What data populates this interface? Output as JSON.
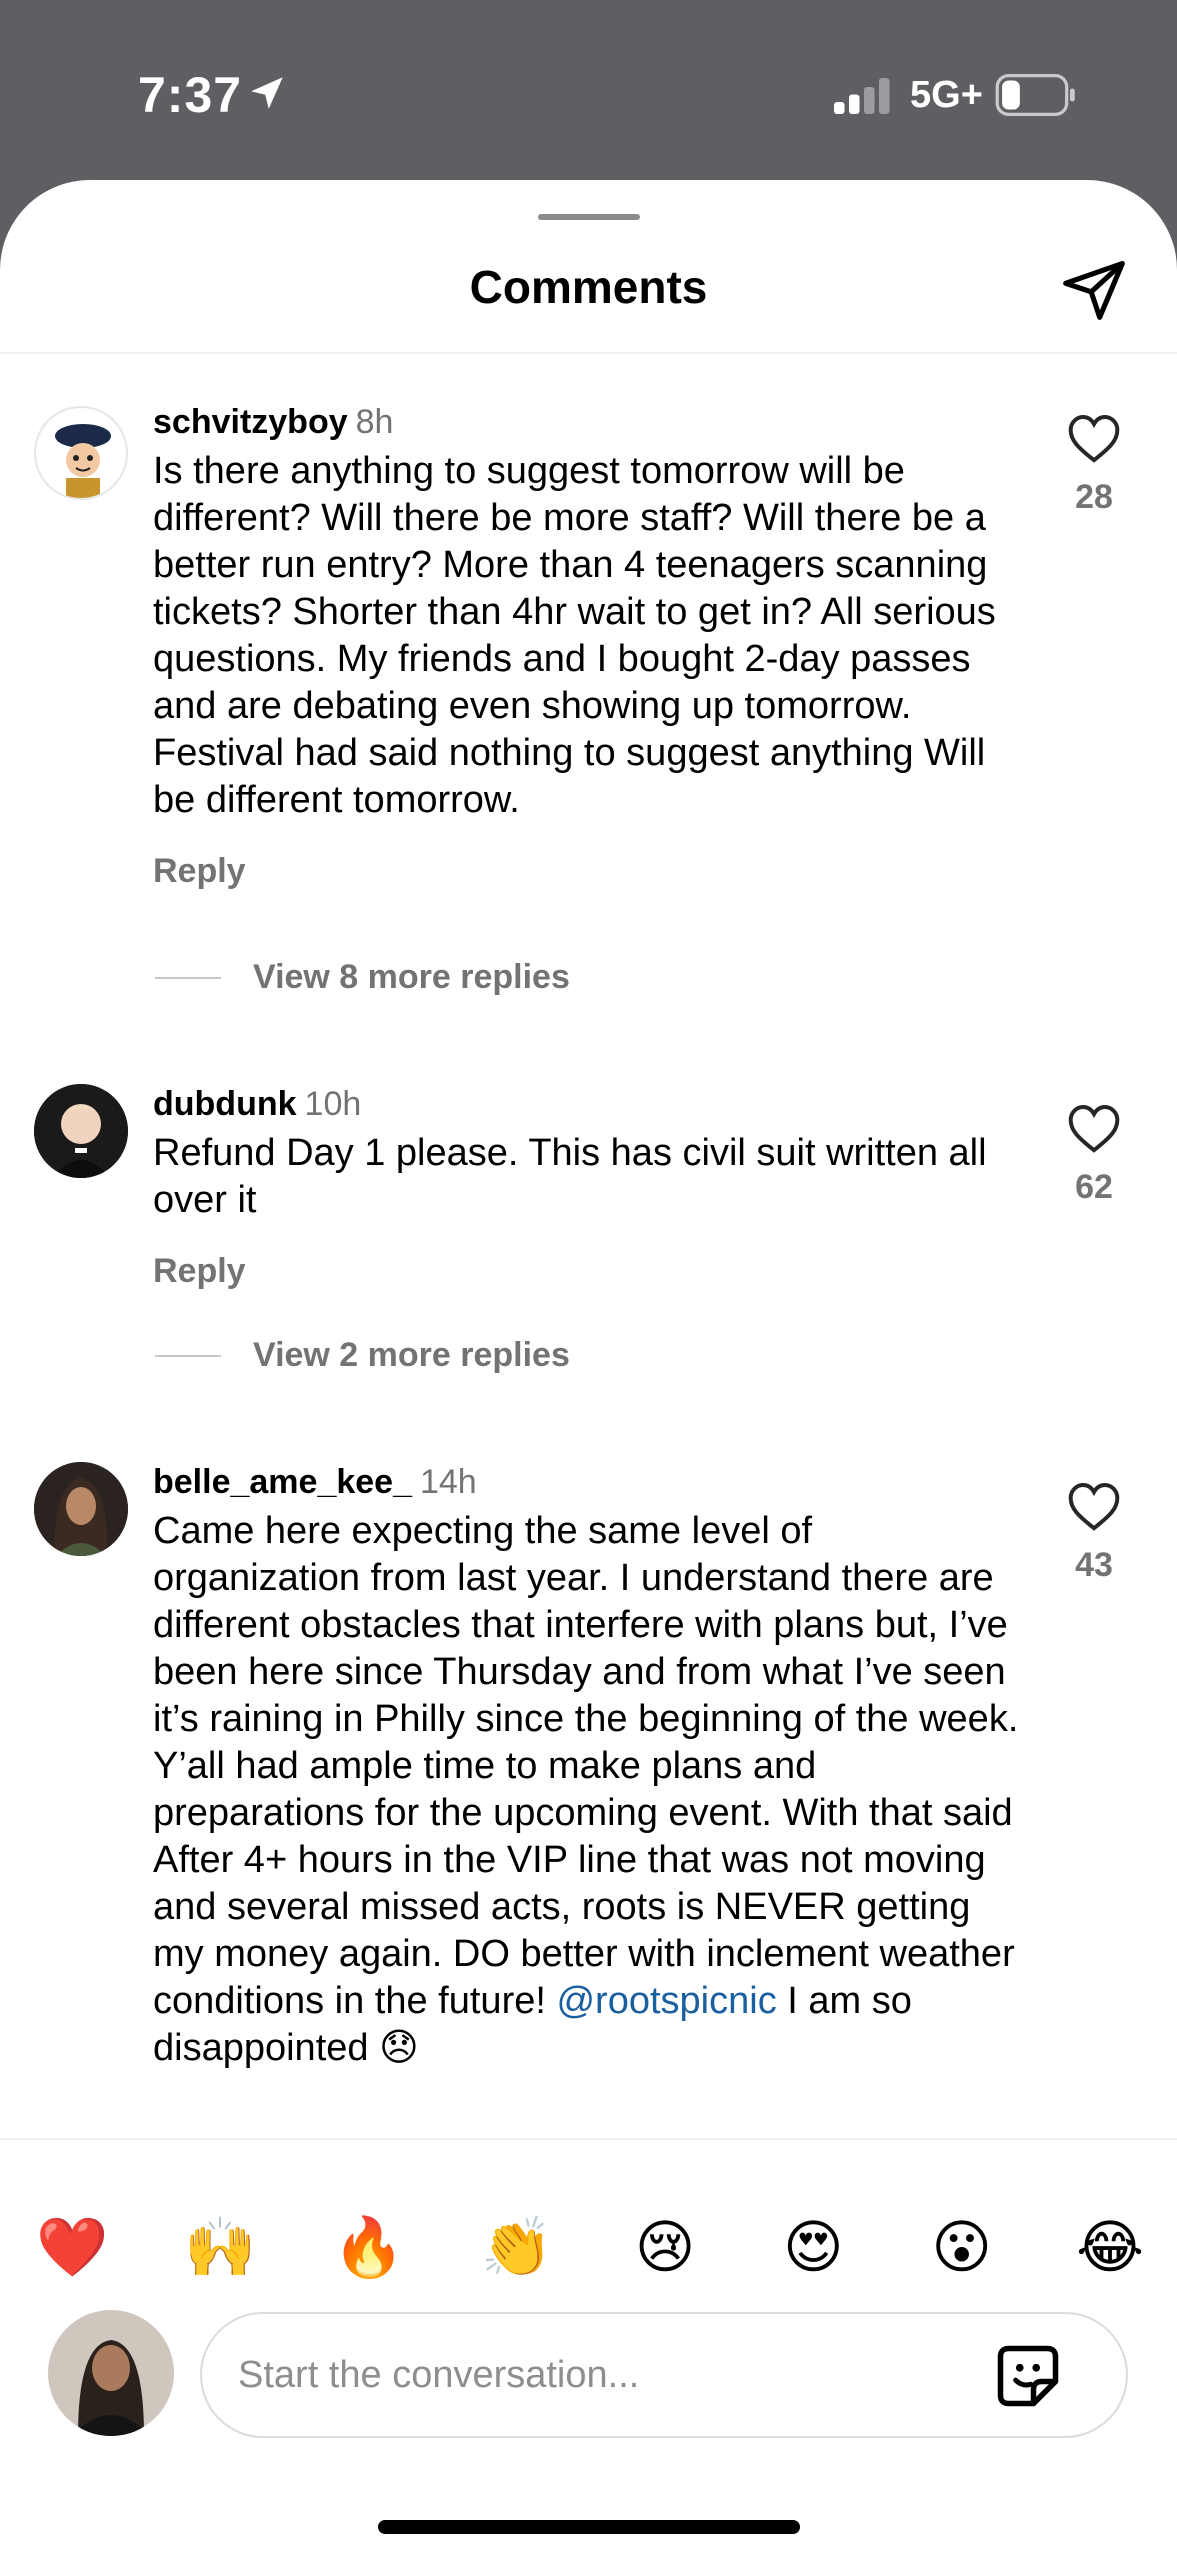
{
  "status_bar": {
    "time": "7:37",
    "network": "5G+"
  },
  "header": {
    "title": "Comments"
  },
  "comments": [
    {
      "username": "schvitzyboy",
      "time": "8h",
      "text": "Is there anything to suggest tomorrow will be different? Will there be more staff? Will there be a better run entry? More than 4 teenagers scanning tickets? Shorter than 4hr wait to get in? All serious questions. My friends and I bought 2-day passes and are debating even showing up tomorrow. Festival had said nothing to suggest anything Will be different tomorrow.",
      "likes": "28",
      "reply_label": "Reply",
      "view_replies": "View 8 more replies"
    },
    {
      "username": "dubdunk",
      "time": "10h",
      "text": "Refund Day 1 please. This has civil suit written all over it",
      "likes": "62",
      "reply_label": "Reply",
      "view_replies": "View 2 more replies"
    },
    {
      "username": "belle_ame_kee_",
      "time": "14h",
      "text": "Came here expecting the same level of organization from last year. I understand there are different obstacles that interfere with plans but,  I’ve been here since Thursday and from what I’ve seen it’s raining in Philly since the beginning of the week. Y’all had ample time to make plans and preparations for the upcoming event. With that said After 4+ hours in the VIP line that was not moving and several missed acts, roots is NEVER getting my money again. DO better with inclement weather conditions in the future! ",
      "mention": "@rootspicnic",
      "text_after": " I am so disappointed 😞",
      "likes": "43"
    }
  ],
  "emoji_bar": [
    "❤️",
    "🙌",
    "🔥",
    "👏",
    "😢",
    "😍",
    "😮",
    "😂"
  ],
  "composer": {
    "placeholder": "Start the conversation..."
  }
}
